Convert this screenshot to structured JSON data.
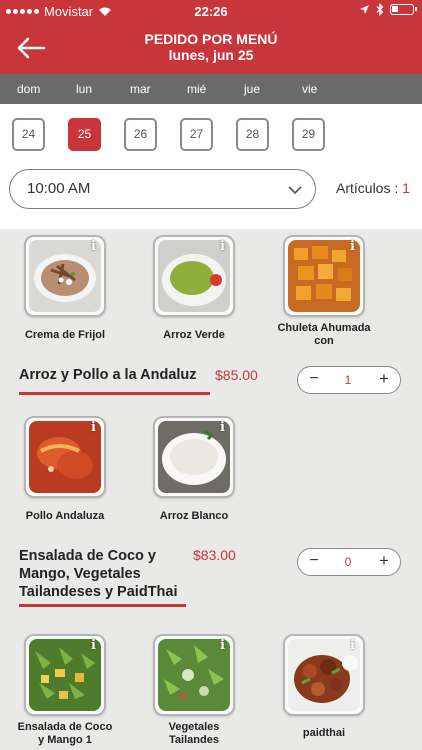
{
  "status": {
    "carrier": "Movistar",
    "time": "22:26"
  },
  "header": {
    "title": "PEDIDO POR MENÚ",
    "subtitle": "lunes, jun 25"
  },
  "days": [
    "dom",
    "lun",
    "mar",
    "mié",
    "jue",
    "vie"
  ],
  "dates": [
    {
      "label": "24",
      "selected": false
    },
    {
      "label": "25",
      "selected": true
    },
    {
      "label": "26",
      "selected": false
    },
    {
      "label": "27",
      "selected": false
    },
    {
      "label": "28",
      "selected": false
    },
    {
      "label": "29",
      "selected": false
    }
  ],
  "time_select": {
    "value": "10:00 AM"
  },
  "articulos": {
    "label": "Artículos :",
    "count": "1"
  },
  "info_glyph": "i",
  "colors": {
    "brand": "#c8353a",
    "day_bar": "#6a6a6a",
    "background": "#e9e9e8"
  },
  "menu": {
    "row1": [
      {
        "name": "Crema de Frijol",
        "image": "bean-soup"
      },
      {
        "name": "Arroz Verde",
        "image": "green-rice"
      },
      {
        "name": "Chuleta Ahumada con",
        "image": "smoked-chop"
      }
    ],
    "combo1": {
      "title": "Arroz y Pollo a la Andaluz",
      "price": "$85.00",
      "qty": "1"
    },
    "row2": [
      {
        "name": "Pollo Andaluza",
        "image": "andalusian-chicken"
      },
      {
        "name": "Arroz Blanco",
        "image": "white-rice"
      }
    ],
    "combo2": {
      "title_lines": [
        "Ensalada de Coco y",
        "Mango, Vegetales",
        "Tailandeses y PaidThai"
      ],
      "price": "$83.00",
      "qty": "0"
    },
    "row3": [
      {
        "name_lines": [
          "Ensalada de Coco",
          "y Mango 1"
        ],
        "image": "coconut-mango-salad"
      },
      {
        "name_lines": [
          "Vegetales",
          "Tailandes"
        ],
        "image": "thai-vegetables"
      },
      {
        "name": "paidthai",
        "image": "pad-thai"
      }
    ]
  }
}
